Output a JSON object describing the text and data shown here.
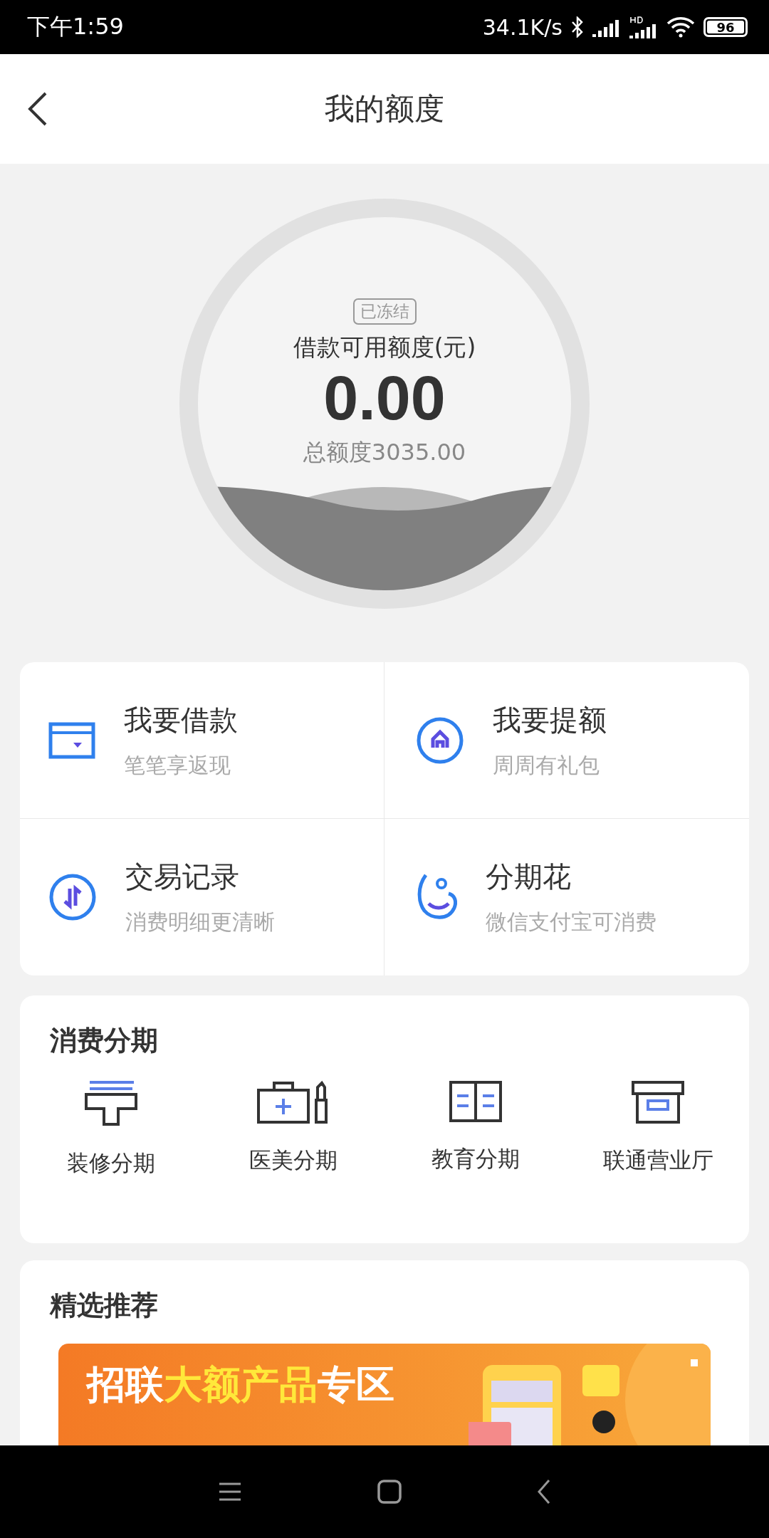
{
  "status_bar": {
    "time": "下午1:59",
    "speed": "34.1K/s",
    "battery": "96"
  },
  "header": {
    "title": "我的额度"
  },
  "gauge": {
    "frozen": true,
    "badge": "已冻结",
    "label": "借款可用额度(元)",
    "amount": "0.00",
    "total": "总额度3035.00"
  },
  "actions": [
    {
      "kind": "card",
      "title": "我要借款",
      "subtitle": "笔笔享返现"
    },
    {
      "kind": "raise",
      "title": "我要提额",
      "subtitle": "周周有礼包"
    },
    {
      "kind": "records",
      "title": "交易记录",
      "subtitle": "消费明细更清晰"
    },
    {
      "kind": "flower",
      "title": "分期花",
      "subtitle": "微信支付宝可消费"
    }
  ],
  "installments": {
    "title": "消费分期",
    "items": [
      {
        "kind": "decor",
        "label": "装修分期"
      },
      {
        "kind": "medical",
        "label": "医美分期"
      },
      {
        "kind": "education",
        "label": "教育分期"
      },
      {
        "kind": "store",
        "label": "联通营业厅"
      }
    ]
  },
  "featured": {
    "title": "精选推荐",
    "banner": {
      "title_parts": [
        {
          "text": "招联",
          "highlight": false
        },
        {
          "text": "大额产品",
          "highlight": true
        },
        {
          "text": "专区",
          "highlight": false
        }
      ]
    }
  }
}
